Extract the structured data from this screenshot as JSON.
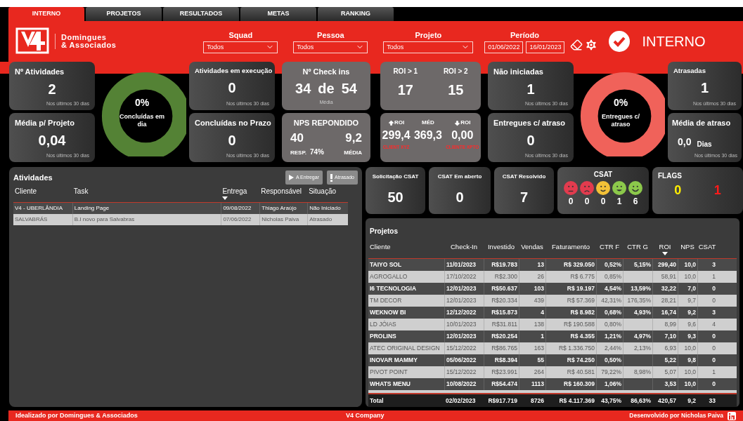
{
  "tabs": [
    {
      "label": "INTERNO",
      "selected": true
    },
    {
      "label": "PROJETOS",
      "selected": false
    },
    {
      "label": "RESULTADOS",
      "selected": false
    },
    {
      "label": "METAS",
      "selected": false
    },
    {
      "label": "RANKING",
      "selected": false
    }
  ],
  "header": {
    "company": [
      "Domingues",
      "& Associados"
    ],
    "filters": [
      {
        "label": "Squad",
        "value": "Todos"
      },
      {
        "label": "Pessoa",
        "value": "Todos"
      },
      {
        "label": "Projeto",
        "value": "Todos"
      }
    ],
    "period": {
      "label": "Período",
      "start": "01/06/2022",
      "end": "16/01/2023"
    },
    "page_title": "INTERNO"
  },
  "kpis": {
    "atividades": {
      "title": "Nº Atividades",
      "value": "2",
      "note": "Nos últimos 30 dias"
    },
    "media_projeto": {
      "title": "Média p/ Projeto",
      "value": "0,04",
      "note": "Nos últimos 30 dias"
    },
    "concluidas_em_dia": {
      "value": "0%",
      "label": "Concluídas em dia"
    },
    "em_execucao": {
      "title": "Atividades em execução",
      "value": "0",
      "note": "Nos últimos 30 dias"
    },
    "concluidas_prazo": {
      "title": "Concluídas no Prazo",
      "value": "0",
      "note": "Nos últimos 30 dias"
    },
    "check_ins": {
      "title": "Nº Check ins",
      "done": "34",
      "of": "de",
      "total": "54",
      "note": "Média"
    },
    "nps": {
      "title": "NPS REPONDIDO",
      "responses": "40",
      "responses_label": "RESP.",
      "rate": "74%",
      "average": "9,2",
      "average_label": "MÉDIA"
    },
    "roi_counts": [
      {
        "label": "ROI > 1",
        "value": "17"
      },
      {
        "label": "ROI > 2",
        "value": "15"
      }
    ],
    "roi_stats": [
      {
        "kind": "up",
        "label": "ROI",
        "value": "299,4",
        "note": "CLIENT XYZ"
      },
      {
        "kind": "plain",
        "label": "MÉD",
        "value": "369,3"
      },
      {
        "kind": "down",
        "label": "ROI",
        "value": "0,00",
        "note": "CLIENTE XPTO"
      }
    ],
    "nao_iniciadas": {
      "title": "Não iniciadas",
      "value": "1",
      "note": "Nos últimos 30 dias"
    },
    "entregues_atraso": {
      "title": "Entregues c/ atraso",
      "value": "0",
      "note": "Nos últimos 30 dias"
    },
    "entregues_atraso_pct": {
      "value": "0%",
      "label": "Entregues c/ atraso"
    },
    "atrasadas": {
      "title": "Atrasadas",
      "value": "1",
      "note": "Nos últimos 30 dias"
    },
    "media_atraso": {
      "title": "Média de atraso",
      "value": "0,0",
      "unit": "Dias",
      "note": "Nos últimos 30 dias"
    }
  },
  "atividades": {
    "title": "Atividades",
    "buttons": [
      {
        "kind": "play",
        "label": "A Entregar"
      },
      {
        "kind": "alert",
        "label": "Atrasado"
      }
    ],
    "columns": [
      {
        "label": "Cliente",
        "sorted": false
      },
      {
        "label": "Task",
        "sorted": false
      },
      {
        "label": "Entrega",
        "sorted": true
      },
      {
        "label": "Responsável",
        "sorted": false
      },
      {
        "label": "Situação",
        "sorted": false
      }
    ],
    "rows": [
      [
        "V4 - UBERLÂNDIA",
        "Landing Page",
        "09/08/2022",
        "Thiago Araújo",
        "Não Iniciado"
      ],
      [
        "SALVABRÁS",
        "B.I novo para Salvabras",
        "07/06/2022",
        "Nicholas Paiva",
        "Atrasado"
      ]
    ]
  },
  "csat_cards": [
    {
      "title": "Solicitação CSAT",
      "value": "50"
    },
    {
      "title": "CSAT Em aberto",
      "value": "0"
    },
    {
      "title": "CSAT Resolvido",
      "value": "7"
    }
  ],
  "csat": {
    "title": "CSAT",
    "faces": [
      {
        "kind": "meh",
        "color": "#e23b4e",
        "count": "0"
      },
      {
        "kind": "sad",
        "color": "#e23b4e",
        "count": "0"
      },
      {
        "kind": "smile",
        "color": "#f2c037",
        "count": "0"
      },
      {
        "kind": "grin",
        "color": "#8cc84b",
        "count": "1"
      },
      {
        "kind": "happy",
        "color": "#8cc84b",
        "count": "6"
      }
    ]
  },
  "flags": {
    "title": "FLAGS",
    "values": [
      {
        "value": "0",
        "color": "#ffee00"
      },
      {
        "value": "1",
        "color": "#ff1a1a"
      }
    ]
  },
  "projetos": {
    "title": "Projetos",
    "columns": [
      {
        "label": "Cliente",
        "sorted": false
      },
      {
        "label": "Check-In",
        "sorted": false
      },
      {
        "label": "Investido",
        "sorted": false
      },
      {
        "label": "Vendas",
        "sorted": false
      },
      {
        "label": "Faturamento",
        "sorted": false
      },
      {
        "label": "CTR F",
        "sorted": false
      },
      {
        "label": "CTR G",
        "sorted": false
      },
      {
        "label": "ROI",
        "sorted": true
      },
      {
        "label": "NPS",
        "sorted": false
      },
      {
        "label": "CSAT",
        "sorted": false
      }
    ],
    "rows": [
      [
        "TAIYO SOL",
        "11/01/2023",
        "R$19.783",
        "13",
        "R$ 329.050",
        "0,52%",
        "5,15%",
        "299,40",
        "10,0",
        "3"
      ],
      [
        "AGROGALLO",
        "17/10/2022",
        "R$2.300",
        "26",
        "R$ 6.775",
        "0,85%",
        null,
        "58,91",
        "10,0",
        "1"
      ],
      [
        "I6 TECNOLOGIA",
        "12/01/2023",
        "R$50.637",
        "103",
        "R$ 19.197",
        "4,54%",
        "13,59%",
        "32,22",
        "7,0",
        "0"
      ],
      [
        "TM DECOR",
        "12/01/2023",
        "R$20.334",
        "439",
        "R$ 57.369",
        "42,31%",
        "176,35%",
        "28,21",
        "9,7",
        "0"
      ],
      [
        "WEKNOW BI",
        "12/12/2022",
        "R$15.873",
        "4",
        "R$ 8.982",
        "0,68%",
        "4,93%",
        "16,74",
        "9,2",
        "3"
      ],
      [
        "LD JÓIAS",
        "10/01/2023",
        "R$31.811",
        "138",
        "R$ 190.588",
        "0,80%",
        null,
        "8,99",
        "9,6",
        "4"
      ],
      [
        "PROLINS",
        "12/01/2023",
        "R$20.254",
        "1",
        "R$ 4.355",
        "1,21%",
        "4,97%",
        "7,10",
        "9,3",
        "0"
      ],
      [
        "ATEC ORIGINAL DESIGN",
        "15/12/2022",
        "R$86.765",
        "163",
        "R$ 1.336.750",
        "2,44%",
        "2,13%",
        "6,93",
        "10,0",
        "0"
      ],
      [
        "INOVAR MAMMY",
        "05/06/2022",
        "R$8.394",
        "55",
        "R$ 74.250",
        "0,50%",
        null,
        "5,22",
        "9,8",
        "0"
      ],
      [
        "PIVOT POINT",
        "15/12/2022",
        "R$23.991",
        "264",
        "R$ 40.581",
        "79,22%",
        "8,98%",
        "5,07",
        "10,0",
        "1"
      ],
      [
        "WHATS MENU",
        "10/08/2022",
        "R$54.474",
        "1113",
        "R$ 160.309",
        "1,06%",
        null,
        "3,53",
        "10,0",
        "0"
      ]
    ],
    "total": [
      "Total",
      "02/02/2023",
      "R$917.719",
      "8726",
      "R$ 4.117.369",
      "43,75%",
      "86,63%",
      "420,57",
      "9,2",
      "33"
    ]
  },
  "footer": {
    "left": "Idealizado por Domingues & Associados",
    "center": "V4 Company",
    "right": "Desenvolvido por Nicholas Paiva"
  }
}
